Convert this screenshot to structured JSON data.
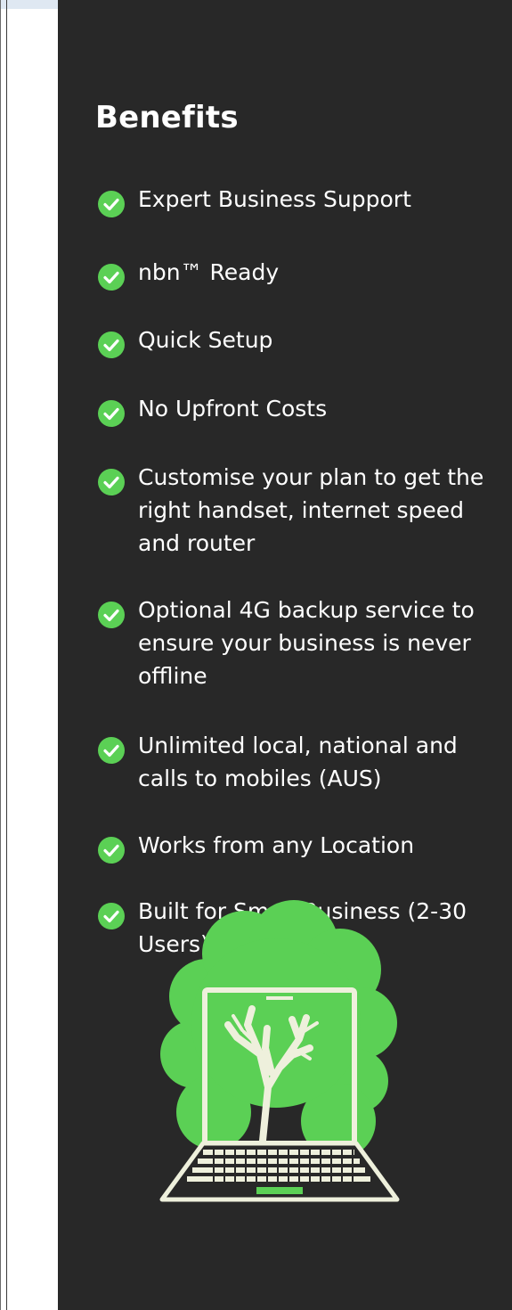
{
  "sidebar": {
    "heading": "Benefits",
    "accent_color": "#5bd055",
    "background_color": "#282828",
    "benefits": [
      {
        "label": "Expert Business Support",
        "icon": "check-circle-icon"
      },
      {
        "label": "nbn™ Ready",
        "icon": "check-circle-icon"
      },
      {
        "label": "Quick Setup",
        "icon": "check-circle-icon"
      },
      {
        "label": "No Upfront Costs",
        "icon": "check-circle-icon"
      },
      {
        "label": "Customise your plan to get the right handset, internet speed and router",
        "icon": "check-circle-icon"
      },
      {
        "label": "Optional 4G backup service to ensure your business is never offline",
        "icon": "check-circle-icon"
      },
      {
        "label": "Unlimited local, national and calls to mobiles (AUS)",
        "icon": "check-circle-icon"
      },
      {
        "label": "Works from any Location",
        "icon": "check-circle-icon"
      },
      {
        "label": "Built for Small Business (2-30 Users)",
        "icon": "check-circle-icon"
      }
    ],
    "illustration": "tree-laptop-illustration"
  }
}
